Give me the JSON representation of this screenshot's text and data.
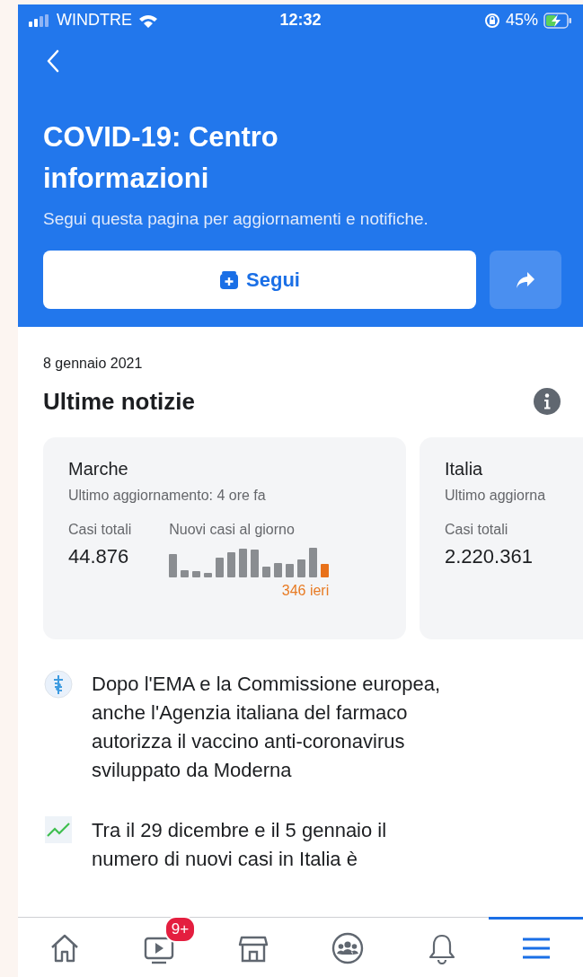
{
  "status_bar": {
    "carrier": "WINDTRE",
    "time": "12:32",
    "battery": "45%"
  },
  "header": {
    "title": "COVID-19: Centro informazioni",
    "subtitle": "Segui questa pagina per aggiornamenti e notifiche.",
    "follow_button": "Segui"
  },
  "date": "8 gennaio 2021",
  "section_title": "Ultime notizie",
  "cards": [
    {
      "region": "Marche",
      "updated": "Ultimo aggiornamento: 4 ore fa",
      "total_label": "Casi totali",
      "total": "44.876",
      "chart_label": "Nuovi casi al giorno",
      "chart_note": "346 ieri"
    },
    {
      "region": "Italia",
      "updated": "Ultimo aggiorna",
      "total_label": "Casi totali",
      "total": "2.220.361"
    }
  ],
  "news": [
    {
      "kind": "medical",
      "text": "Dopo l'EMA e la Commissione europea,\nanche l'Agenzia italiana del farmaco\nautorizza il vaccino anti-coronavirus\nsviluppato da Moderna"
    },
    {
      "kind": "trend",
      "text": "Tra il 29 dicembre e il 5 gennaio il\nnumero di nuovi casi in Italia è"
    }
  ],
  "tab_bar": [
    {
      "kind": "home",
      "selected": false
    },
    {
      "kind": "video",
      "selected": false,
      "badge": "9+"
    },
    {
      "kind": "store",
      "selected": false
    },
    {
      "kind": "groups",
      "selected": false
    },
    {
      "kind": "bell",
      "selected": false
    },
    {
      "kind": "menu",
      "selected": true
    }
  ]
}
